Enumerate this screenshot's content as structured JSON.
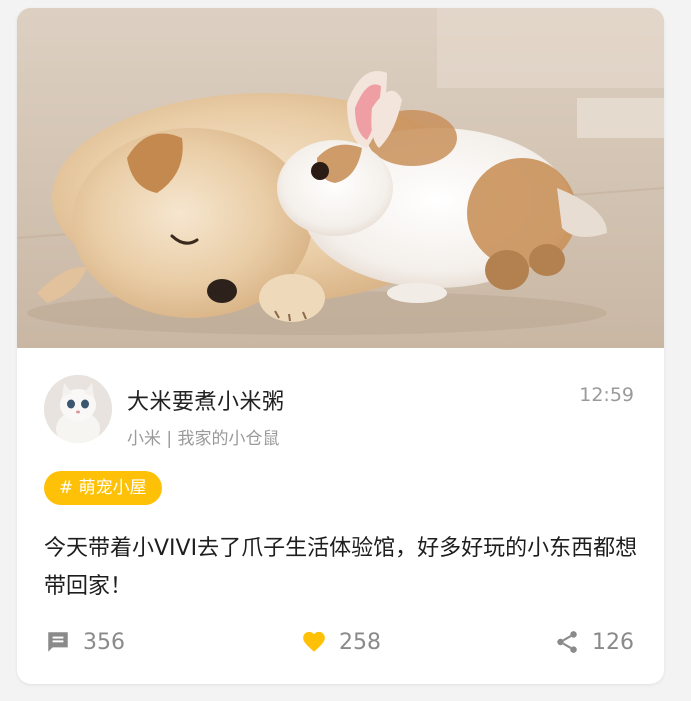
{
  "post": {
    "image_alt": "puppy and rabbit sleeping",
    "author": {
      "name": "大米要煮小米粥",
      "subtitle": "小米 | 我家的小仓鼠"
    },
    "time": "12:59",
    "tag": "# 萌宠小屋",
    "content": "今天带着小VIVI去了爪子生活体验馆，好多好玩的小东西都想带回家！",
    "stats": {
      "comments": "356",
      "likes": "258",
      "shares": "126"
    }
  },
  "icons": {
    "comment": "comment-icon",
    "like": "heart-icon",
    "share": "share-icon"
  },
  "colors": {
    "tag_bg": "#ffc107",
    "like": "#ffc107",
    "muted": "#8a8a8a",
    "card_bg": "#ffffff",
    "page_bg": "#f3f3f3"
  }
}
